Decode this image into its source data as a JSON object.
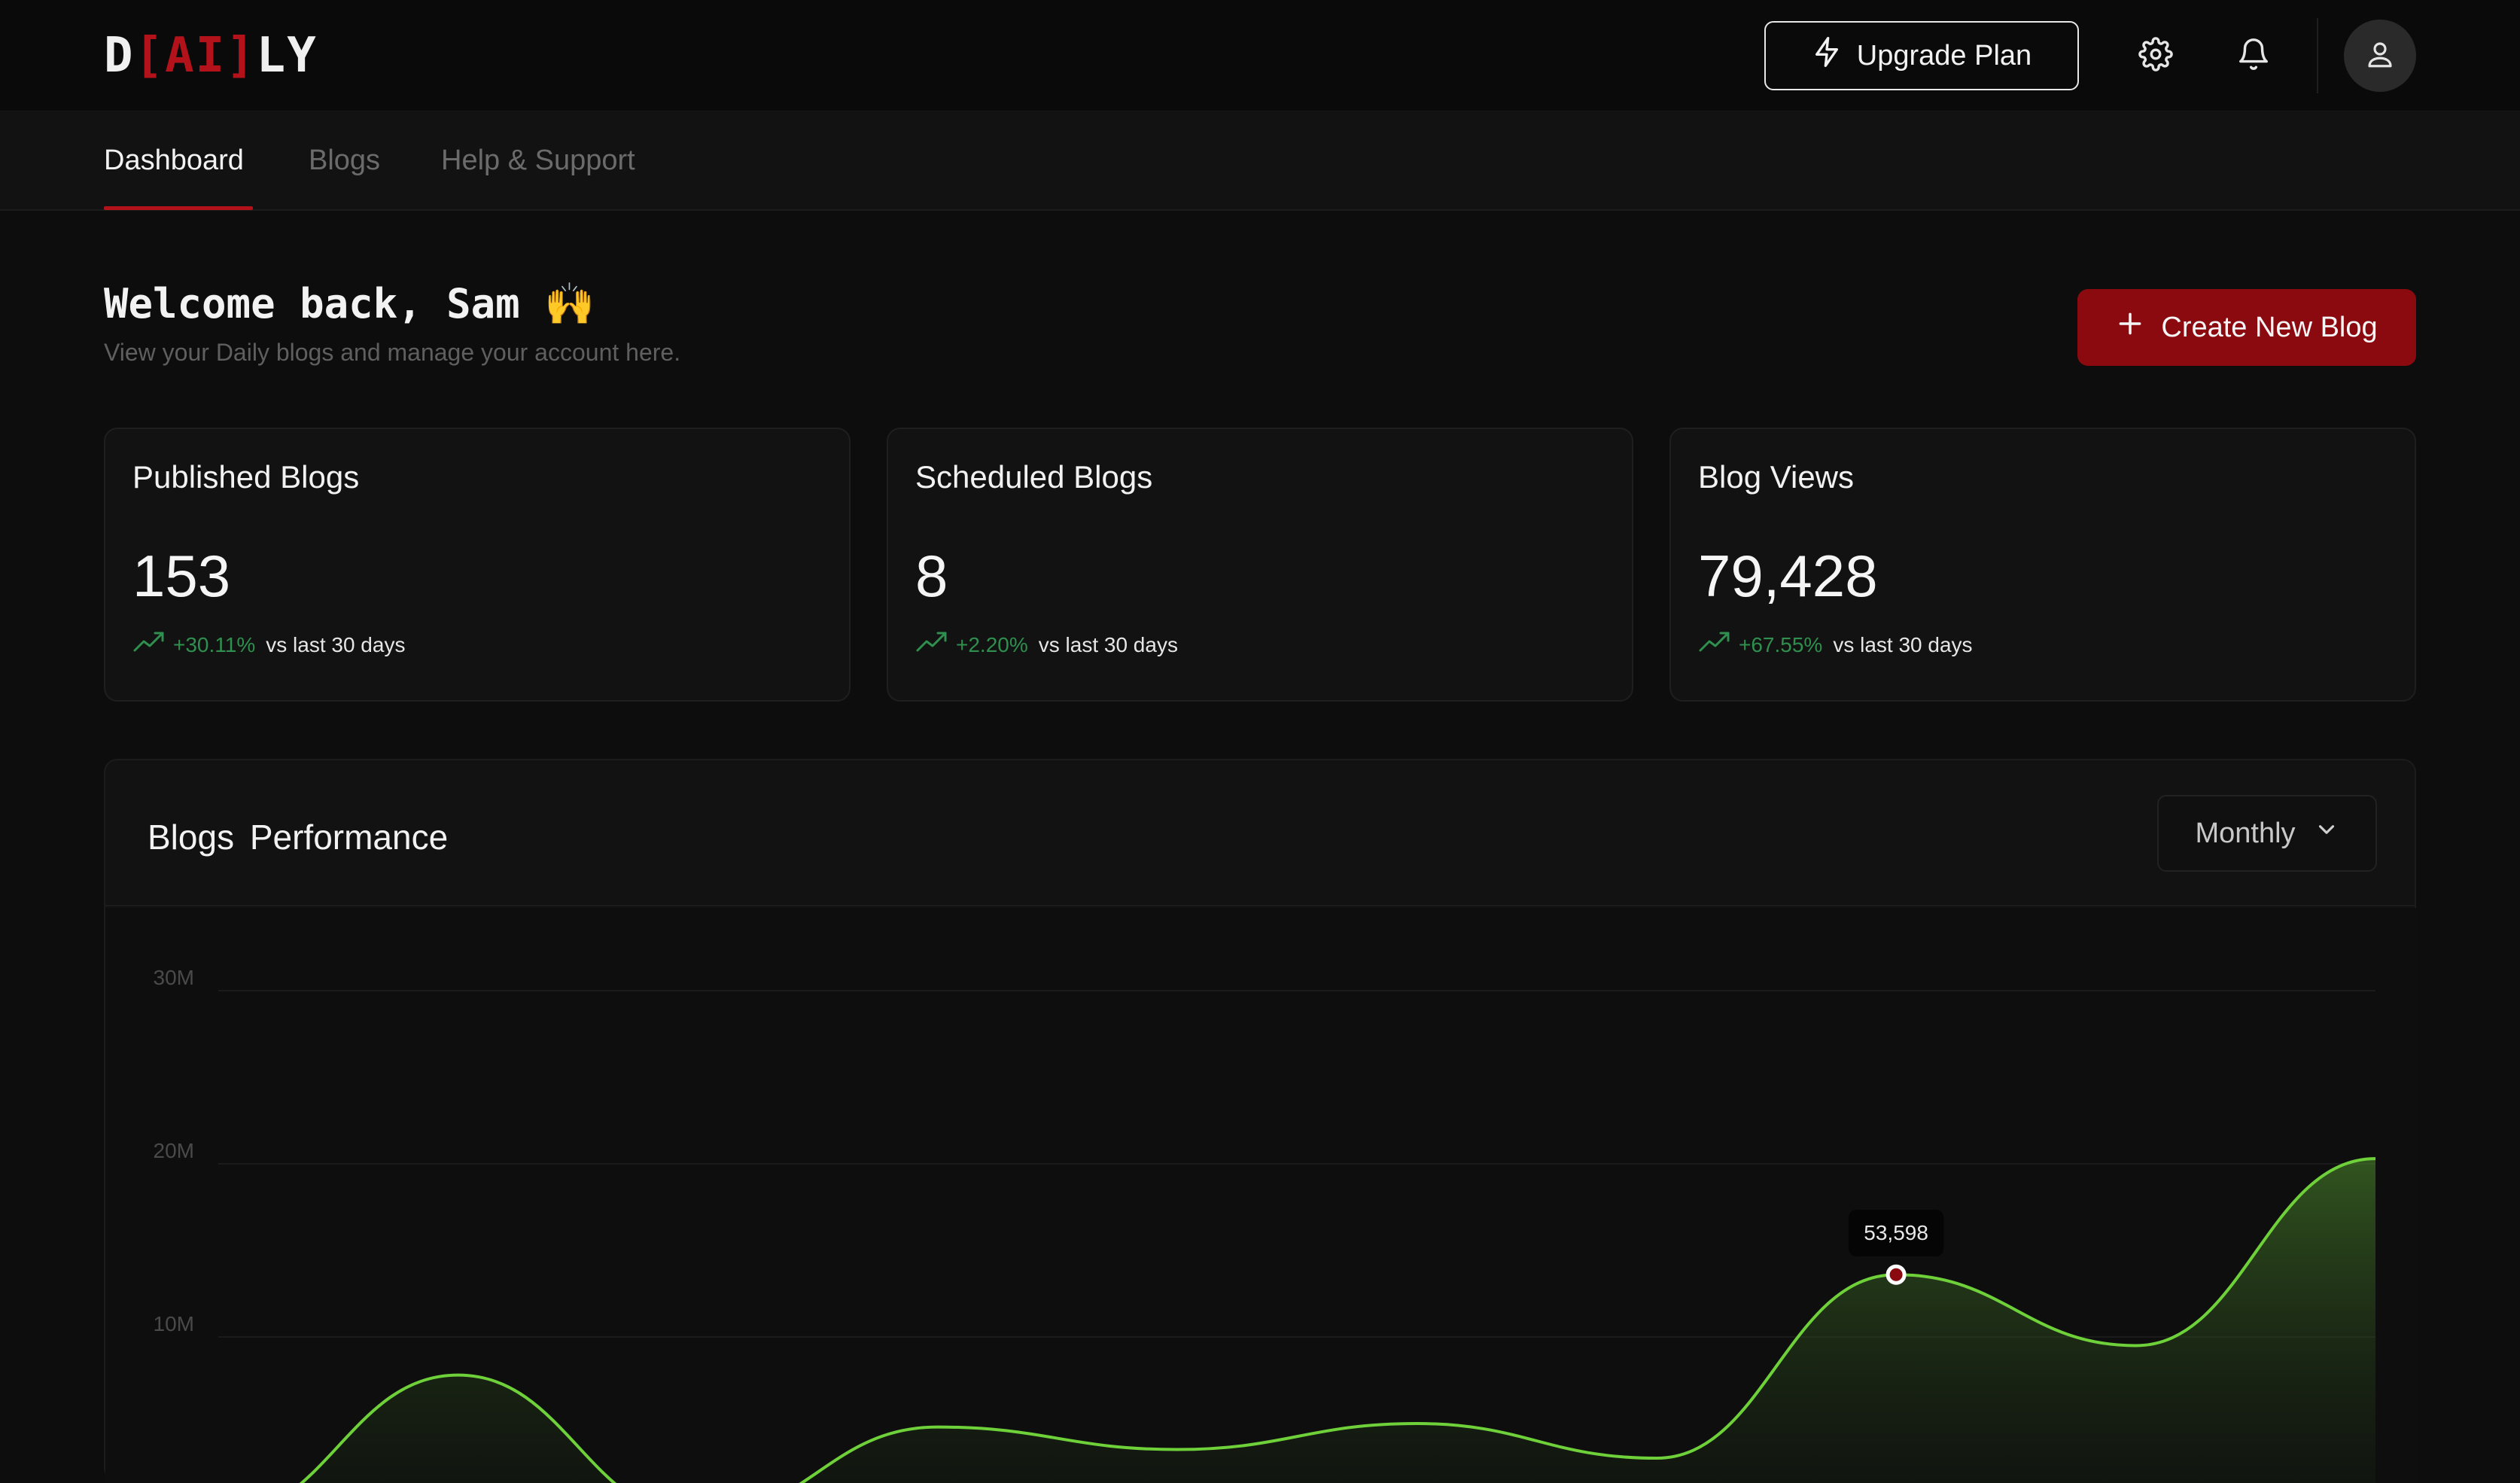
{
  "app": {
    "logo_parts": [
      "D",
      "[AI]",
      "LY"
    ]
  },
  "header": {
    "upgrade_label": "Upgrade Plan",
    "icons": [
      "bolt-icon",
      "gear-icon",
      "bell-icon",
      "user-icon"
    ]
  },
  "nav": {
    "tabs": [
      {
        "label": "Dashboard",
        "active": true
      },
      {
        "label": "Blogs",
        "active": false
      },
      {
        "label": "Help & Support",
        "active": false
      }
    ]
  },
  "welcome": {
    "title": "Welcome back, Sam 🙌",
    "subtitle": "View your Daily blogs and manage your account here.",
    "create_label": "Create New Blog"
  },
  "stats": [
    {
      "title": "Published Blogs",
      "value": "153",
      "change": "+30.11%",
      "period": "vs last 30 days"
    },
    {
      "title": "Scheduled Blogs",
      "value": "8",
      "change": "+2.20%",
      "period": "vs last 30 days"
    },
    {
      "title": "Blog Views",
      "value": "79,428",
      "change": "+67.55%",
      "period": "vs last 30 days"
    }
  ],
  "performance": {
    "title": "Blogs  Performance",
    "period_selected": "Monthly"
  },
  "colors": {
    "accent_red": "#b3121b",
    "button_red": "#8b0a0f",
    "trend_green": "#2f8f4e",
    "line_green": "#6fd13a"
  },
  "chart_data": {
    "type": "area",
    "title": "Blogs  Performance",
    "yticks": [
      "30M",
      "20M",
      "10M"
    ],
    "ylim": [
      0,
      30
    ],
    "y_unit": "M",
    "x": [
      0,
      1,
      2,
      3,
      4,
      5,
      6,
      7,
      8,
      9
    ],
    "series": [
      {
        "values": [
          0,
          7.8,
          0,
          4.8,
          3.5,
          5.0,
          3.0,
          13.6,
          9.5,
          20.3
        ]
      }
    ],
    "highlight": {
      "index": 7,
      "label": "53,598"
    },
    "grid": true
  }
}
